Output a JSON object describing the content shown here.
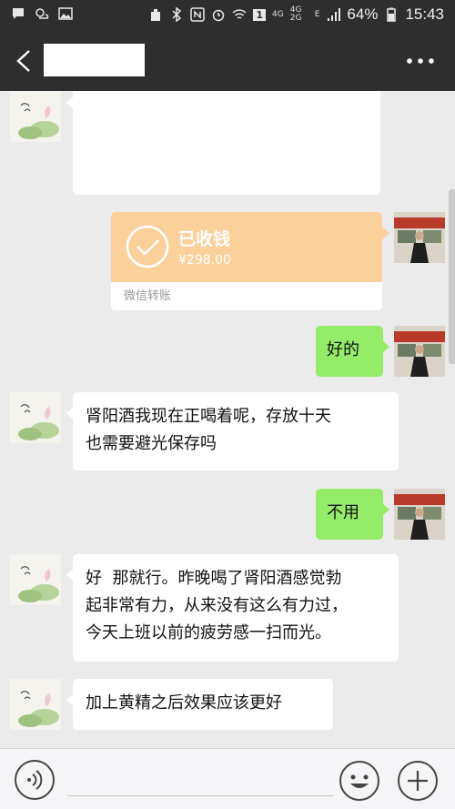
{
  "status_bar": {
    "net_4g": "4G",
    "net_4g2g": "4G 2G",
    "net_e": "E",
    "battery": "64%",
    "time": "15:43",
    "sim_slot": "1"
  },
  "header": {
    "back_icon": "chevron-left-icon",
    "more_icon": "more-dots-icon"
  },
  "messages": [
    {
      "side": "left",
      "type": "text",
      "text": ""
    },
    {
      "side": "right",
      "type": "transfer",
      "title": "已收钱",
      "amount": "¥298.00",
      "footer": "微信转账"
    },
    {
      "side": "right",
      "type": "text",
      "text": "好的"
    },
    {
      "side": "left",
      "type": "text",
      "lines": [
        "肾阳酒我现在正喝着呢，存放十天",
        "也需要避光保存吗"
      ]
    },
    {
      "side": "right",
      "type": "text",
      "text": "不用"
    },
    {
      "side": "left",
      "type": "text",
      "lines": [
        "好  那就行。昨晚喝了肾阳酒感觉勃",
        "起非常有力，从来没有这么有力过，",
        "今天上班以前的疲劳感一扫而光。"
      ]
    },
    {
      "side": "left",
      "type": "text",
      "text": "加上黄精之后效果应该更好"
    }
  ],
  "input_bar": {
    "voice_icon": "voice-icon",
    "emoji_icon": "emoji-icon",
    "plus_icon": "plus-icon",
    "draft": ""
  },
  "colors": {
    "bar_bg": "#2e2e2e",
    "chat_bg": "#ebebeb",
    "green_bubble": "#95ec69",
    "transfer_orange": "#fbd09a"
  }
}
